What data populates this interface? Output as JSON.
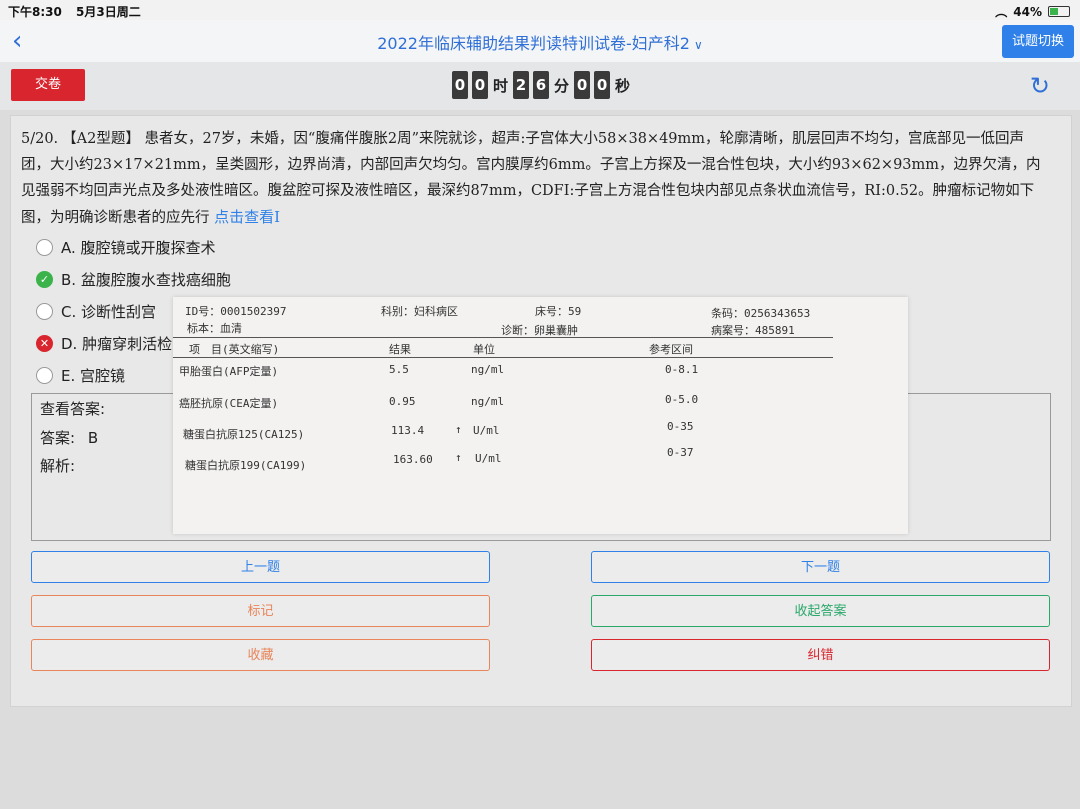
{
  "status_bar": {
    "time": "下午8:30",
    "date": "5月3日周二",
    "battery": "44%"
  },
  "nav": {
    "back_icon": "chevron-left-icon",
    "title": "2022年临床辅助结果判读特训试卷-妇产科2",
    "title_chevron": "∨",
    "switch_label": "试题切换"
  },
  "toolbar": {
    "submit_label": "交卷",
    "timer": {
      "h1": "0",
      "h2": "0",
      "h_unit": "时",
      "m1": "2",
      "m2": "6",
      "m_unit": "分",
      "s1": "0",
      "s2": "0",
      "s_unit": "秒"
    }
  },
  "question": {
    "number": "5/20.",
    "type": "【A2型题】",
    "text": "患者女，27岁，未婚，因“腹痛伴腹胀2周”来院就诊，超声:子宫体大小58×38×49mm，轮廓清晰，肌层回声不均匀，宫底部见一低回声团，大小约23×17×21mm，呈类圆形，边界尚清，内部回声欠均匀。宫内膜厚约6mm。子宫上方探及一混合性包块，大小约93×62×93mm，边界欠清，内见强弱不均回声光点及多处液性暗区。腹盆腔可探及液性暗区，最深约87mm，CDFI:子宫上方混合性包块内部见点条状血流信号，RI:0.52。肿瘤标记物如下图，为明确诊断患者的应先行",
    "link": "点击查看I"
  },
  "options": [
    {
      "label": "A. 腹腔镜或开腹探查术",
      "state": "none"
    },
    {
      "label": "B. 盆腹腔腹水查找癌细胞",
      "state": "correct"
    },
    {
      "label": "C. 诊断性刮宫",
      "state": "none"
    },
    {
      "label": "D. 肿瘤穿刺活检",
      "state": "wrong"
    },
    {
      "label": "E. 宫腔镜",
      "state": "none"
    }
  ],
  "answer_box": {
    "view_label": "查看答案:",
    "answer_label": "答案:",
    "answer_value": "B",
    "analysis_label": "解析:"
  },
  "buttons": {
    "prev": "上一题",
    "next": "下一题",
    "mark": "标记",
    "hide_answer": "收起答案",
    "favorite": "收藏",
    "correct_error": "纠错"
  },
  "report": {
    "id": "ID号：0001502397",
    "dept": "科别：妇科病区",
    "bed": "床号：59",
    "barcode": "条码：0256343653",
    "specimen": "标本：血清",
    "diagnosis": "诊断：卵巢囊肿",
    "case_no": "病案号：485891",
    "headers": [
      "项　目(英文缩写)",
      "结果",
      "单位",
      "参考区间"
    ],
    "rows": [
      {
        "item": "甲胎蛋白(AFP定量)",
        "result": "5.5",
        "flag": "",
        "unit": "ng/ml",
        "ref": "0-8.1"
      },
      {
        "item": "癌胚抗原(CEA定量)",
        "result": "0.95",
        "flag": "",
        "unit": "ng/ml",
        "ref": "0-5.0"
      },
      {
        "item": "糖蛋白抗原125(CA125)",
        "result": "113.4",
        "flag": "↑",
        "unit": "U/ml",
        "ref": "0-35"
      },
      {
        "item": "糖蛋白抗原199(CA199)",
        "result": "163.60",
        "flag": "↑",
        "unit": "U/ml",
        "ref": "0-37"
      }
    ]
  }
}
